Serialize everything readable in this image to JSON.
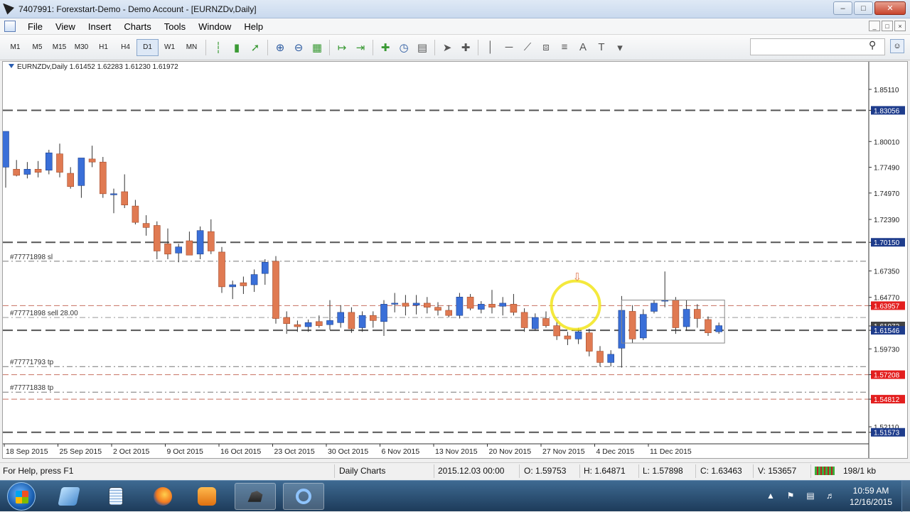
{
  "window": {
    "title": "7407991: Forexstart-Demo - Demo Account - [EURNZDv,Daily]",
    "buttons": {
      "minimize": "–",
      "maximize": "□",
      "close": "✕"
    }
  },
  "menu": {
    "items": [
      "File",
      "View",
      "Insert",
      "Charts",
      "Tools",
      "Window",
      "Help"
    ],
    "mdi_buttons": [
      "_",
      "□",
      "×"
    ]
  },
  "toolbar": {
    "timeframes": [
      "M1",
      "M5",
      "M15",
      "M30",
      "H1",
      "H4",
      "D1",
      "W1",
      "MN"
    ],
    "active_timeframe": "D1",
    "icons": [
      "bar-chart-icon",
      "candlestick-icon",
      "line-chart-icon",
      "zoom-in-icon",
      "zoom-out-icon",
      "tile-icon",
      "autoscroll-icon",
      "chart-shift-icon",
      "indicators-icon",
      "periods-icon",
      "templates-icon",
      "cursor-icon",
      "crosshair-icon",
      "vertical-line-icon",
      "horizontal-line-icon",
      "trendline-icon",
      "channel-icon",
      "fibonacci-icon",
      "text-icon",
      "text-label-icon",
      "shapes-icon"
    ],
    "text_tool_label": "A",
    "text_label_tool_label": "T"
  },
  "chart": {
    "header": "EURNZDv,Daily  1.61452 1.62283 1.61230 1.61972",
    "price_labels": [
      {
        "text": "1.85110",
        "price": 1.8511,
        "style": "plain"
      },
      {
        "text": "1.83056",
        "price": 1.83056,
        "style": "blue"
      },
      {
        "text": "1.80010",
        "price": 1.8001,
        "style": "plain"
      },
      {
        "text": "1.77490",
        "price": 1.7749,
        "style": "plain"
      },
      {
        "text": "1.74970",
        "price": 1.7497,
        "style": "plain"
      },
      {
        "text": "1.72390",
        "price": 1.7239,
        "style": "plain"
      },
      {
        "text": "1.70150",
        "price": 1.7015,
        "style": "blue"
      },
      {
        "text": "1.67350",
        "price": 1.6735,
        "style": "plain"
      },
      {
        "text": "1.64770",
        "price": 1.6477,
        "style": "plain"
      },
      {
        "text": "1.63957",
        "price": 1.63957,
        "style": "red"
      },
      {
        "text": "1.61972",
        "price": 1.61972,
        "style": "darkgray"
      },
      {
        "text": "1.61546",
        "price": 1.61546,
        "style": "blue"
      },
      {
        "text": "1.59730",
        "price": 1.5973,
        "style": "plain"
      },
      {
        "text": "1.57208",
        "price": 1.57208,
        "style": "red"
      },
      {
        "text": "1.54812",
        "price": 1.54812,
        "style": "red"
      },
      {
        "text": "1.52110",
        "price": 1.5211,
        "style": "plain"
      },
      {
        "text": "1.51573",
        "price": 1.51573,
        "style": "blue"
      }
    ],
    "horizontal_lines": [
      {
        "price": 1.83056,
        "color": "#555555",
        "dash": "14,6",
        "width": 2
      },
      {
        "price": 1.7015,
        "color": "#555555",
        "dash": "14,6",
        "width": 2
      },
      {
        "price": 1.683,
        "color": "#777777",
        "dash": "8,4,2,4",
        "width": 1
      },
      {
        "price": 1.63957,
        "color": "#c87060",
        "dash": "8,4",
        "width": 1
      },
      {
        "price": 1.628,
        "color": "#999999",
        "dash": "8,4,2,4",
        "width": 1
      },
      {
        "price": 1.61546,
        "color": "#555555",
        "dash": "14,6",
        "width": 2
      },
      {
        "price": 1.58,
        "color": "#777777",
        "dash": "8,4,2,4",
        "width": 1
      },
      {
        "price": 1.57208,
        "color": "#c87060",
        "dash": "8,4",
        "width": 1
      },
      {
        "price": 1.555,
        "color": "#777777",
        "dash": "8,4,2,4",
        "width": 1
      },
      {
        "price": 1.54812,
        "color": "#c87060",
        "dash": "8,4",
        "width": 1
      },
      {
        "price": 1.51573,
        "color": "#555555",
        "dash": "14,6",
        "width": 2
      }
    ],
    "order_labels": [
      {
        "text": "#77771898 sl",
        "price": 1.683
      },
      {
        "text": "#77771898 sell 28.00",
        "price": 1.628
      },
      {
        "text": "#77771793 tp",
        "price": 1.58
      },
      {
        "text": "#77771838 tp",
        "price": 1.555
      }
    ],
    "date_labels": [
      "18 Sep 2015",
      "25 Sep 2015",
      "2 Oct 2015",
      "9 Oct 2015",
      "16 Oct 2015",
      "23 Oct 2015",
      "30 Oct 2015",
      "6 Nov 2015",
      "13 Nov 2015",
      "20 Nov 2015",
      "27 Nov 2015",
      "4 Dec 2015",
      "11 Dec 2015"
    ],
    "colors": {
      "bull": "#3a6fd8",
      "bear": "#e07a52",
      "grid": "#cccccc"
    }
  },
  "chart_data": {
    "type": "candlestick",
    "symbol": "EURNZDv",
    "timeframe": "Daily",
    "ylim": [
      1.51,
      1.86
    ],
    "series": [
      {
        "o": 1.775,
        "h": 1.81,
        "l": 1.755,
        "c": 1.81
      },
      {
        "o": 1.773,
        "h": 1.782,
        "l": 1.766,
        "c": 1.767
      },
      {
        "o": 1.768,
        "h": 1.78,
        "l": 1.764,
        "c": 1.773
      },
      {
        "o": 1.773,
        "h": 1.781,
        "l": 1.765,
        "c": 1.77
      },
      {
        "o": 1.772,
        "h": 1.792,
        "l": 1.768,
        "c": 1.789
      },
      {
        "o": 1.788,
        "h": 1.798,
        "l": 1.765,
        "c": 1.77
      },
      {
        "o": 1.769,
        "h": 1.775,
        "l": 1.754,
        "c": 1.756
      },
      {
        "o": 1.757,
        "h": 1.77,
        "l": 1.745,
        "c": 1.784
      },
      {
        "o": 1.783,
        "h": 1.796,
        "l": 1.775,
        "c": 1.78
      },
      {
        "o": 1.78,
        "h": 1.785,
        "l": 1.745,
        "c": 1.749
      },
      {
        "o": 1.748,
        "h": 1.754,
        "l": 1.73,
        "c": 1.749
      },
      {
        "o": 1.751,
        "h": 1.768,
        "l": 1.735,
        "c": 1.738
      },
      {
        "o": 1.737,
        "h": 1.743,
        "l": 1.719,
        "c": 1.721
      },
      {
        "o": 1.72,
        "h": 1.728,
        "l": 1.708,
        "c": 1.716
      },
      {
        "o": 1.718,
        "h": 1.722,
        "l": 1.685,
        "c": 1.693
      },
      {
        "o": 1.7,
        "h": 1.715,
        "l": 1.685,
        "c": 1.69
      },
      {
        "o": 1.691,
        "h": 1.7,
        "l": 1.682,
        "c": 1.697
      },
      {
        "o": 1.703,
        "h": 1.712,
        "l": 1.692,
        "c": 1.689
      },
      {
        "o": 1.69,
        "h": 1.717,
        "l": 1.685,
        "c": 1.713
      },
      {
        "o": 1.712,
        "h": 1.724,
        "l": 1.69,
        "c": 1.693
      },
      {
        "o": 1.692,
        "h": 1.697,
        "l": 1.652,
        "c": 1.658
      },
      {
        "o": 1.658,
        "h": 1.664,
        "l": 1.646,
        "c": 1.66
      },
      {
        "o": 1.662,
        "h": 1.668,
        "l": 1.651,
        "c": 1.659
      },
      {
        "o": 1.66,
        "h": 1.675,
        "l": 1.653,
        "c": 1.67
      },
      {
        "o": 1.671,
        "h": 1.685,
        "l": 1.66,
        "c": 1.682
      },
      {
        "o": 1.683,
        "h": 1.688,
        "l": 1.622,
        "c": 1.627
      },
      {
        "o": 1.628,
        "h": 1.634,
        "l": 1.612,
        "c": 1.622
      },
      {
        "o": 1.621,
        "h": 1.625,
        "l": 1.614,
        "c": 1.619
      },
      {
        "o": 1.619,
        "h": 1.626,
        "l": 1.614,
        "c": 1.623
      },
      {
        "o": 1.624,
        "h": 1.63,
        "l": 1.618,
        "c": 1.62
      },
      {
        "o": 1.621,
        "h": 1.645,
        "l": 1.616,
        "c": 1.625
      },
      {
        "o": 1.623,
        "h": 1.64,
        "l": 1.618,
        "c": 1.633
      },
      {
        "o": 1.633,
        "h": 1.638,
        "l": 1.613,
        "c": 1.617
      },
      {
        "o": 1.618,
        "h": 1.634,
        "l": 1.614,
        "c": 1.63
      },
      {
        "o": 1.63,
        "h": 1.634,
        "l": 1.618,
        "c": 1.625
      },
      {
        "o": 1.624,
        "h": 1.645,
        "l": 1.61,
        "c": 1.641
      },
      {
        "o": 1.641,
        "h": 1.652,
        "l": 1.633,
        "c": 1.642
      },
      {
        "o": 1.642,
        "h": 1.65,
        "l": 1.63,
        "c": 1.639
      },
      {
        "o": 1.64,
        "h": 1.65,
        "l": 1.631,
        "c": 1.642
      },
      {
        "o": 1.642,
        "h": 1.648,
        "l": 1.632,
        "c": 1.638
      },
      {
        "o": 1.638,
        "h": 1.643,
        "l": 1.63,
        "c": 1.635
      },
      {
        "o": 1.635,
        "h": 1.64,
        "l": 1.628,
        "c": 1.63
      },
      {
        "o": 1.63,
        "h": 1.652,
        "l": 1.627,
        "c": 1.648
      },
      {
        "o": 1.648,
        "h": 1.651,
        "l": 1.635,
        "c": 1.637
      },
      {
        "o": 1.636,
        "h": 1.644,
        "l": 1.632,
        "c": 1.641
      },
      {
        "o": 1.641,
        "h": 1.655,
        "l": 1.632,
        "c": 1.638
      },
      {
        "o": 1.639,
        "h": 1.648,
        "l": 1.63,
        "c": 1.642
      },
      {
        "o": 1.641,
        "h": 1.651,
        "l": 1.63,
        "c": 1.633
      },
      {
        "o": 1.633,
        "h": 1.637,
        "l": 1.614,
        "c": 1.618
      },
      {
        "o": 1.617,
        "h": 1.632,
        "l": 1.615,
        "c": 1.628
      },
      {
        "o": 1.627,
        "h": 1.634,
        "l": 1.618,
        "c": 1.62
      },
      {
        "o": 1.62,
        "h": 1.624,
        "l": 1.606,
        "c": 1.61
      },
      {
        "o": 1.61,
        "h": 1.614,
        "l": 1.601,
        "c": 1.607
      },
      {
        "o": 1.607,
        "h": 1.618,
        "l": 1.602,
        "c": 1.614
      },
      {
        "o": 1.613,
        "h": 1.617,
        "l": 1.59,
        "c": 1.595
      },
      {
        "o": 1.595,
        "h": 1.6,
        "l": 1.58,
        "c": 1.584
      },
      {
        "o": 1.584,
        "h": 1.596,
        "l": 1.58,
        "c": 1.592
      },
      {
        "o": 1.598,
        "h": 1.649,
        "l": 1.579,
        "c": 1.635
      },
      {
        "o": 1.634,
        "h": 1.64,
        "l": 1.603,
        "c": 1.607
      },
      {
        "o": 1.608,
        "h": 1.636,
        "l": 1.606,
        "c": 1.631
      },
      {
        "o": 1.634,
        "h": 1.645,
        "l": 1.632,
        "c": 1.642
      },
      {
        "o": 1.644,
        "h": 1.673,
        "l": 1.638,
        "c": 1.645
      },
      {
        "o": 1.645,
        "h": 1.648,
        "l": 1.612,
        "c": 1.618
      },
      {
        "o": 1.619,
        "h": 1.645,
        "l": 1.615,
        "c": 1.636
      },
      {
        "o": 1.636,
        "h": 1.641,
        "l": 1.618,
        "c": 1.627
      },
      {
        "o": 1.626,
        "h": 1.629,
        "l": 1.61,
        "c": 1.613
      },
      {
        "o": 1.614,
        "h": 1.623,
        "l": 1.612,
        "c": 1.62
      }
    ]
  },
  "annotation": {
    "arrow": "⇩"
  },
  "statusbar": {
    "help": "For Help, press F1",
    "profile": "Daily Charts",
    "datetime": "2015.12.03 00:00",
    "open": "O: 1.59753",
    "high": "H: 1.64871",
    "low": "L: 1.57898",
    "close": "C: 1.63463",
    "volume": "V: 153657",
    "traffic": "198/1 kb"
  },
  "taskbar": {
    "items": [
      "explorer-icon",
      "notepad-icon",
      "firefox-icon",
      "media-player-icon",
      "metatrader-icon",
      "search-app-icon"
    ],
    "clock_time": "10:59 AM",
    "clock_date": "12/16/2015"
  }
}
